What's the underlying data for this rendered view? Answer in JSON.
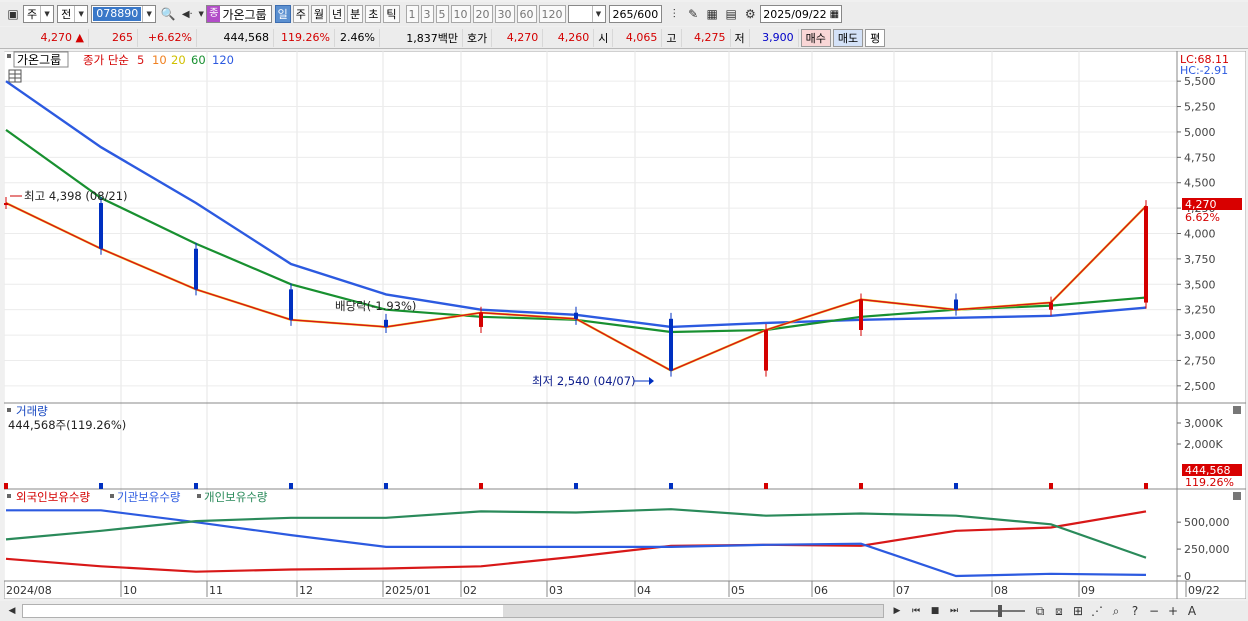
{
  "toolbar": {
    "market": "주",
    "prev": "전",
    "code": "078890",
    "name_tag": "종",
    "name": "가온그룹",
    "periods": [
      "일",
      "주",
      "월",
      "년",
      "분",
      "초",
      "틱"
    ],
    "active_period": "일",
    "intervals": [
      "1",
      "3",
      "5",
      "10",
      "20",
      "30",
      "60",
      "120"
    ],
    "count": "265",
    "count_total": "/600",
    "date": "2025/09/22"
  },
  "quote": {
    "price": "4,270",
    "arrow": "▲",
    "change": "265",
    "change_pct": "+6.62%",
    "volume": "444,568",
    "volume_ratio": "119.26%",
    "turnover": "2.46%",
    "amount": "1,837백만",
    "hoga_label": "호가",
    "ask": "4,270",
    "bid": "4,260",
    "open_label": "시",
    "open": "4,065",
    "high_label": "고",
    "high": "4,275",
    "low_label": "저",
    "low": "3,900",
    "buy": "매수",
    "sell": "매도",
    "eval": "평"
  },
  "price_panel": {
    "name": "가온그룹",
    "ma_label": "종가 단순",
    "ma_periods": [
      "5",
      "10",
      "20",
      "60",
      "120"
    ],
    "lc": "LC:68.11",
    "hc": "HC:-2.91",
    "y_ticks": [
      "5,500",
      "5,250",
      "5,000",
      "4,750",
      "4,500",
      "4,250",
      "4,000",
      "3,750",
      "3,500",
      "3,250",
      "3,000",
      "2,750",
      "2,500"
    ],
    "last_price_badge": "4,270",
    "last_pct_badge": "6.62%",
    "annotation_high": "최고 4,398 (08/21)",
    "annotation_low": "최저 2,540 (04/07)",
    "annotation_div": "배당락(-1.93%)"
  },
  "volume_panel": {
    "title": "거래량",
    "info": "444,568주(119.26%)",
    "y_ticks": [
      "3,000K",
      "2,000K"
    ],
    "badge_value": "444,568",
    "badge_pct": "119.26%"
  },
  "holders_panel": {
    "series_names": [
      "외국인보유수량",
      "기관보유수량",
      "개인보유수량"
    ],
    "y_ticks": [
      "500,000",
      "250,000",
      "0"
    ]
  },
  "x_labels": [
    "2024/08",
    "10",
    "11",
    "12",
    "2025/01",
    "02",
    "03",
    "04",
    "05",
    "06",
    "07",
    "08",
    "09",
    "09/22"
  ],
  "colors": {
    "ma5": "#d81818",
    "ma10": "#f08020",
    "ma20": "#f0e020",
    "ma60": "#189030",
    "ma120": "#2c5ae0",
    "up": "#d40000",
    "down": "#0030c0",
    "foreign": "#d81818",
    "institution": "#2c5ae0",
    "individual": "#2a8a5a"
  },
  "chart_data": {
    "type": "candlestick",
    "x": [
      "2024/08",
      "10",
      "11",
      "12",
      "2025/01",
      "02",
      "03",
      "04",
      "05",
      "06",
      "07",
      "08",
      "09"
    ],
    "close": [
      4300,
      3850,
      3450,
      3150,
      3080,
      3220,
      3160,
      2650,
      3050,
      3350,
      3250,
      3320,
      4270
    ],
    "ma120": [
      5500,
      4850,
      4300,
      3700,
      3400,
      3250,
      3200,
      3080,
      3120,
      3150,
      3170,
      3190,
      3270
    ],
    "ma60": [
      5020,
      4350,
      3900,
      3500,
      3250,
      3180,
      3150,
      3030,
      3050,
      3180,
      3250,
      3290,
      3370
    ],
    "volume_max_label": "3,000K",
    "ylim": [
      2400,
      5600
    ],
    "foreign_holding": [
      160000,
      90000,
      40000,
      60000,
      70000,
      90000,
      180000,
      280000,
      290000,
      280000,
      420000,
      450000,
      600000
    ],
    "institution_holding": [
      610000,
      610000,
      500000,
      380000,
      270000,
      270000,
      270000,
      270000,
      290000,
      300000,
      0,
      20000,
      10000
    ],
    "individual_holding": [
      340000,
      420000,
      510000,
      540000,
      540000,
      600000,
      590000,
      620000,
      560000,
      580000,
      560000,
      480000,
      170000
    ]
  }
}
